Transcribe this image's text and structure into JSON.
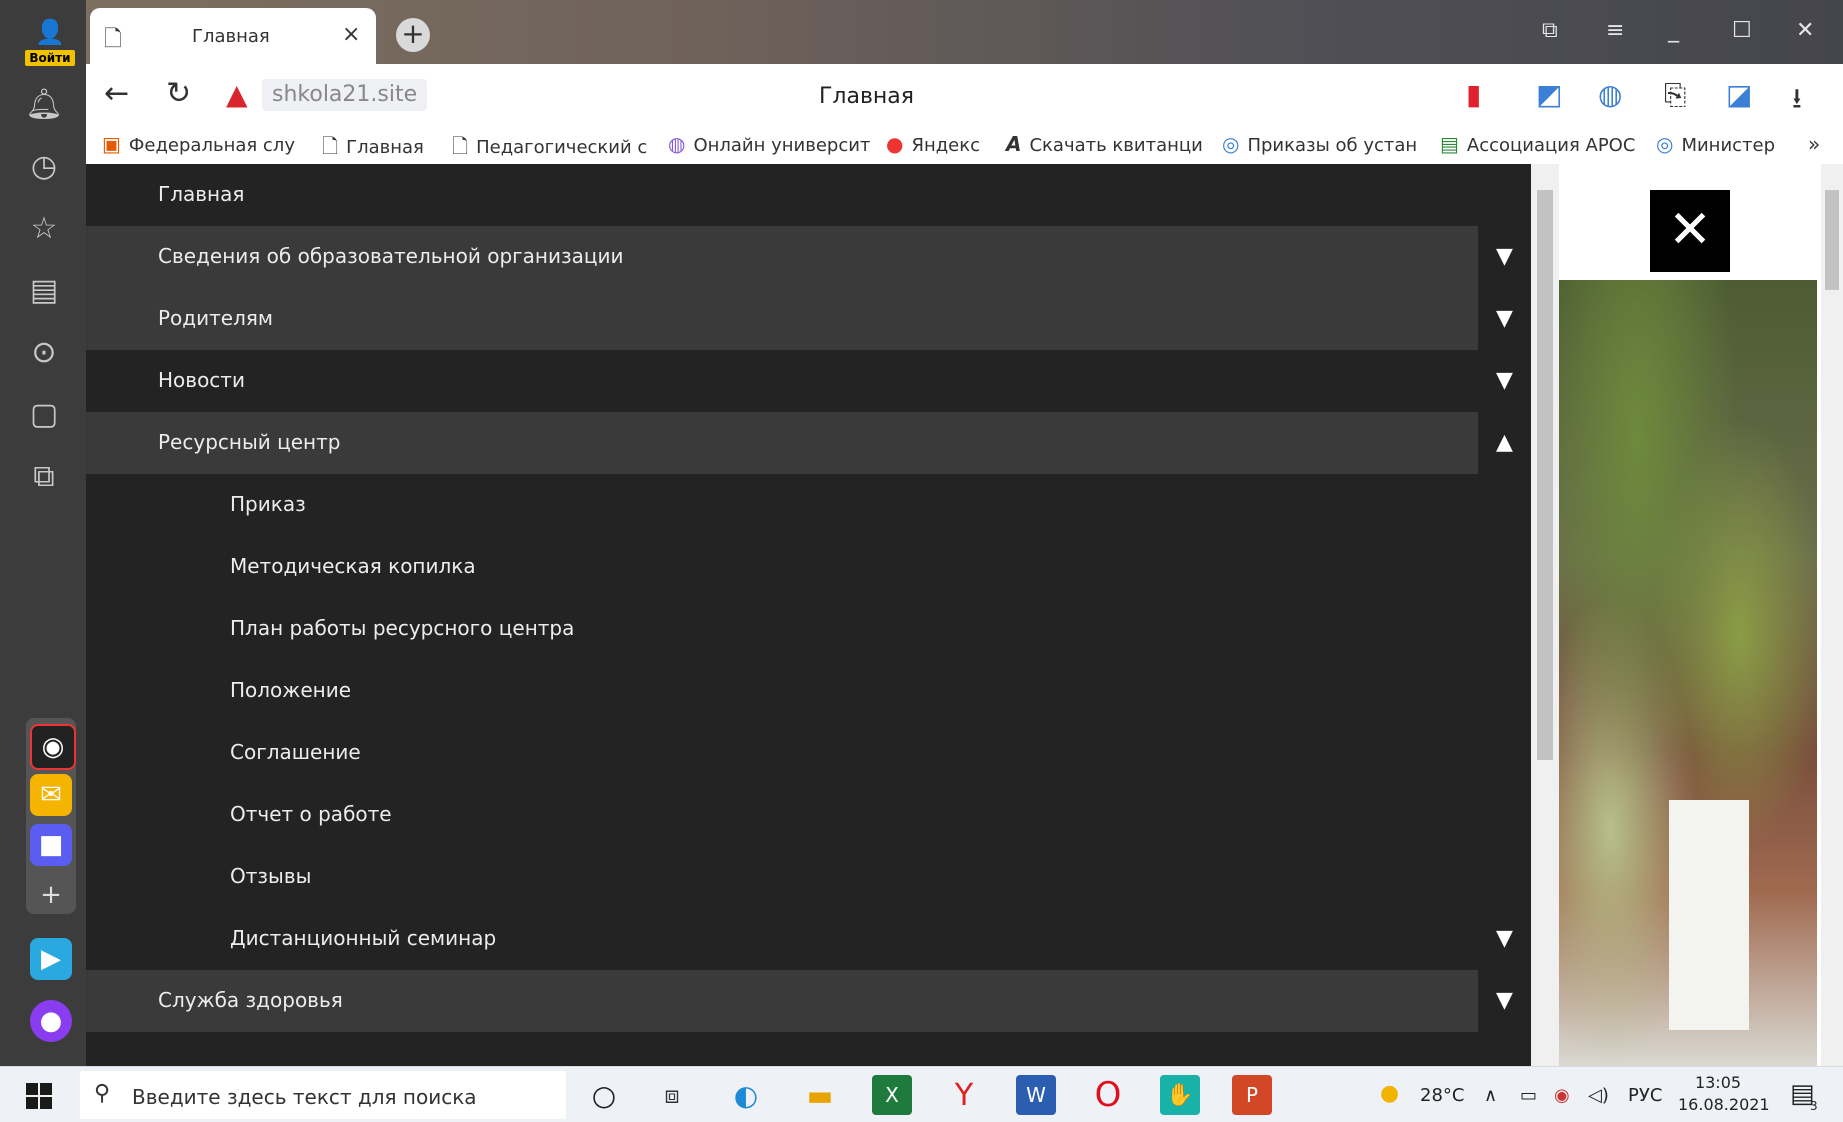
{
  "sidebar": {
    "login_label": "Войти",
    "icons": [
      "bell-icon",
      "history-icon",
      "star-icon",
      "collections-icon",
      "play-icon",
      "calendar-icon",
      "screenshot-icon"
    ],
    "apps": [
      "alice-app",
      "mail-app",
      "messenger-app",
      "add-app",
      "zen-app",
      "alice-orb-app"
    ]
  },
  "tab": {
    "title": "Главная"
  },
  "addressbar": {
    "url": "shkola21.site",
    "page_title": "Главная"
  },
  "bookmarks": [
    {
      "label": "Федеральная слу"
    },
    {
      "label": "Главная"
    },
    {
      "label": "Педагогический с"
    },
    {
      "label": "Онлайн университ"
    },
    {
      "label": "Яндекс"
    },
    {
      "label": "Скачать квитанци"
    },
    {
      "label": "Приказы об устан"
    },
    {
      "label": "Ассоциация АРОС"
    },
    {
      "label": "Министер"
    }
  ],
  "menu": [
    {
      "label": "Главная",
      "arrow": "",
      "sub": false,
      "hl": false
    },
    {
      "label": "Сведения об образовательной организации",
      "arrow": "▼",
      "sub": false,
      "hl": true
    },
    {
      "label": "Родителям",
      "arrow": "▼",
      "sub": false,
      "hl": true
    },
    {
      "label": "Новости",
      "arrow": "▼",
      "sub": false,
      "hl": false
    },
    {
      "label": "Ресурсный центр",
      "arrow": "▲",
      "sub": false,
      "hl": true
    },
    {
      "label": "Приказ",
      "arrow": "",
      "sub": true,
      "hl": false
    },
    {
      "label": "Методическая копилка",
      "arrow": "",
      "sub": true,
      "hl": false
    },
    {
      "label": "План работы ресурсного центра",
      "arrow": "",
      "sub": true,
      "hl": false
    },
    {
      "label": "Положение",
      "arrow": "",
      "sub": true,
      "hl": false
    },
    {
      "label": "Соглашение",
      "arrow": "",
      "sub": true,
      "hl": false
    },
    {
      "label": "Отчет о работе",
      "arrow": "",
      "sub": true,
      "hl": false
    },
    {
      "label": "Отзывы",
      "arrow": "",
      "sub": true,
      "hl": false
    },
    {
      "label": "Дистанционный семинар",
      "arrow": "▼",
      "sub": true,
      "hl": false
    },
    {
      "label": "Служба здоровья",
      "arrow": "▼",
      "sub": false,
      "hl": true
    }
  ],
  "taskbar": {
    "search_placeholder": "Введите здесь текст для поиска",
    "weather": "28°C",
    "language": "РУС",
    "time": "13:05",
    "date": "16.08.2021",
    "notifications": "3"
  }
}
